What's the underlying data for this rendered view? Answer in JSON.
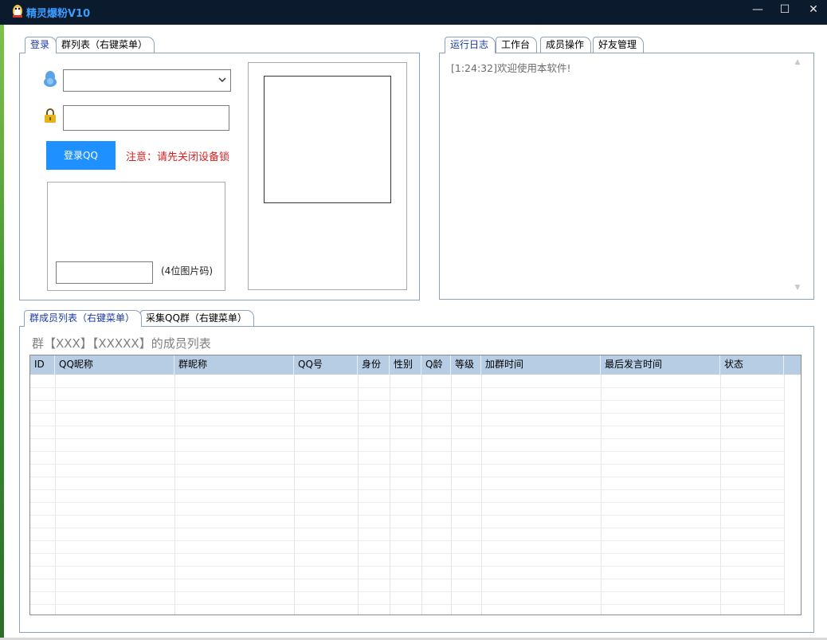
{
  "window": {
    "title": "精灵爆粉V10",
    "minimize": "—",
    "maximize": "☐",
    "close": "✕"
  },
  "left_tabs": [
    {
      "label": "登录",
      "active": true
    },
    {
      "label": "群列表（右键菜单）",
      "active": false
    }
  ],
  "login": {
    "account_icon": "qq-penguin-icon",
    "password_icon": "lock-icon",
    "account_value": "",
    "password_value": "",
    "login_button": "登录QQ",
    "notice": "注意：请先关闭设备锁",
    "captcha_value": "",
    "captcha_hint": "(4位图片码)"
  },
  "right_tabs": [
    {
      "label": "运行日志",
      "active": true
    },
    {
      "label": "工作台",
      "active": false
    },
    {
      "label": "成员操作",
      "active": false
    },
    {
      "label": "好友管理",
      "active": false
    }
  ],
  "log": {
    "lines": [
      "[1:24:32]欢迎使用本软件!"
    ]
  },
  "bottom_tabs": [
    {
      "label": "群成员列表（右键菜单）",
      "active": true
    },
    {
      "label": "采集QQ群（右键菜单）",
      "active": false
    }
  ],
  "member_list": {
    "title": "群【XXX】【XXXXX】的成员列表",
    "columns": [
      "ID",
      "QQ昵称",
      "群昵称",
      "QQ号",
      "身份",
      "性别",
      "Q龄",
      "等级",
      "加群时间",
      "最后发言时间",
      "状态"
    ],
    "rows": []
  },
  "colors": {
    "title_bar": "#0b1a2c",
    "title_text": "#3a9dff",
    "login_button": "#1e90ff",
    "notice": "#d42020",
    "grid_header": "#b6cde4"
  }
}
